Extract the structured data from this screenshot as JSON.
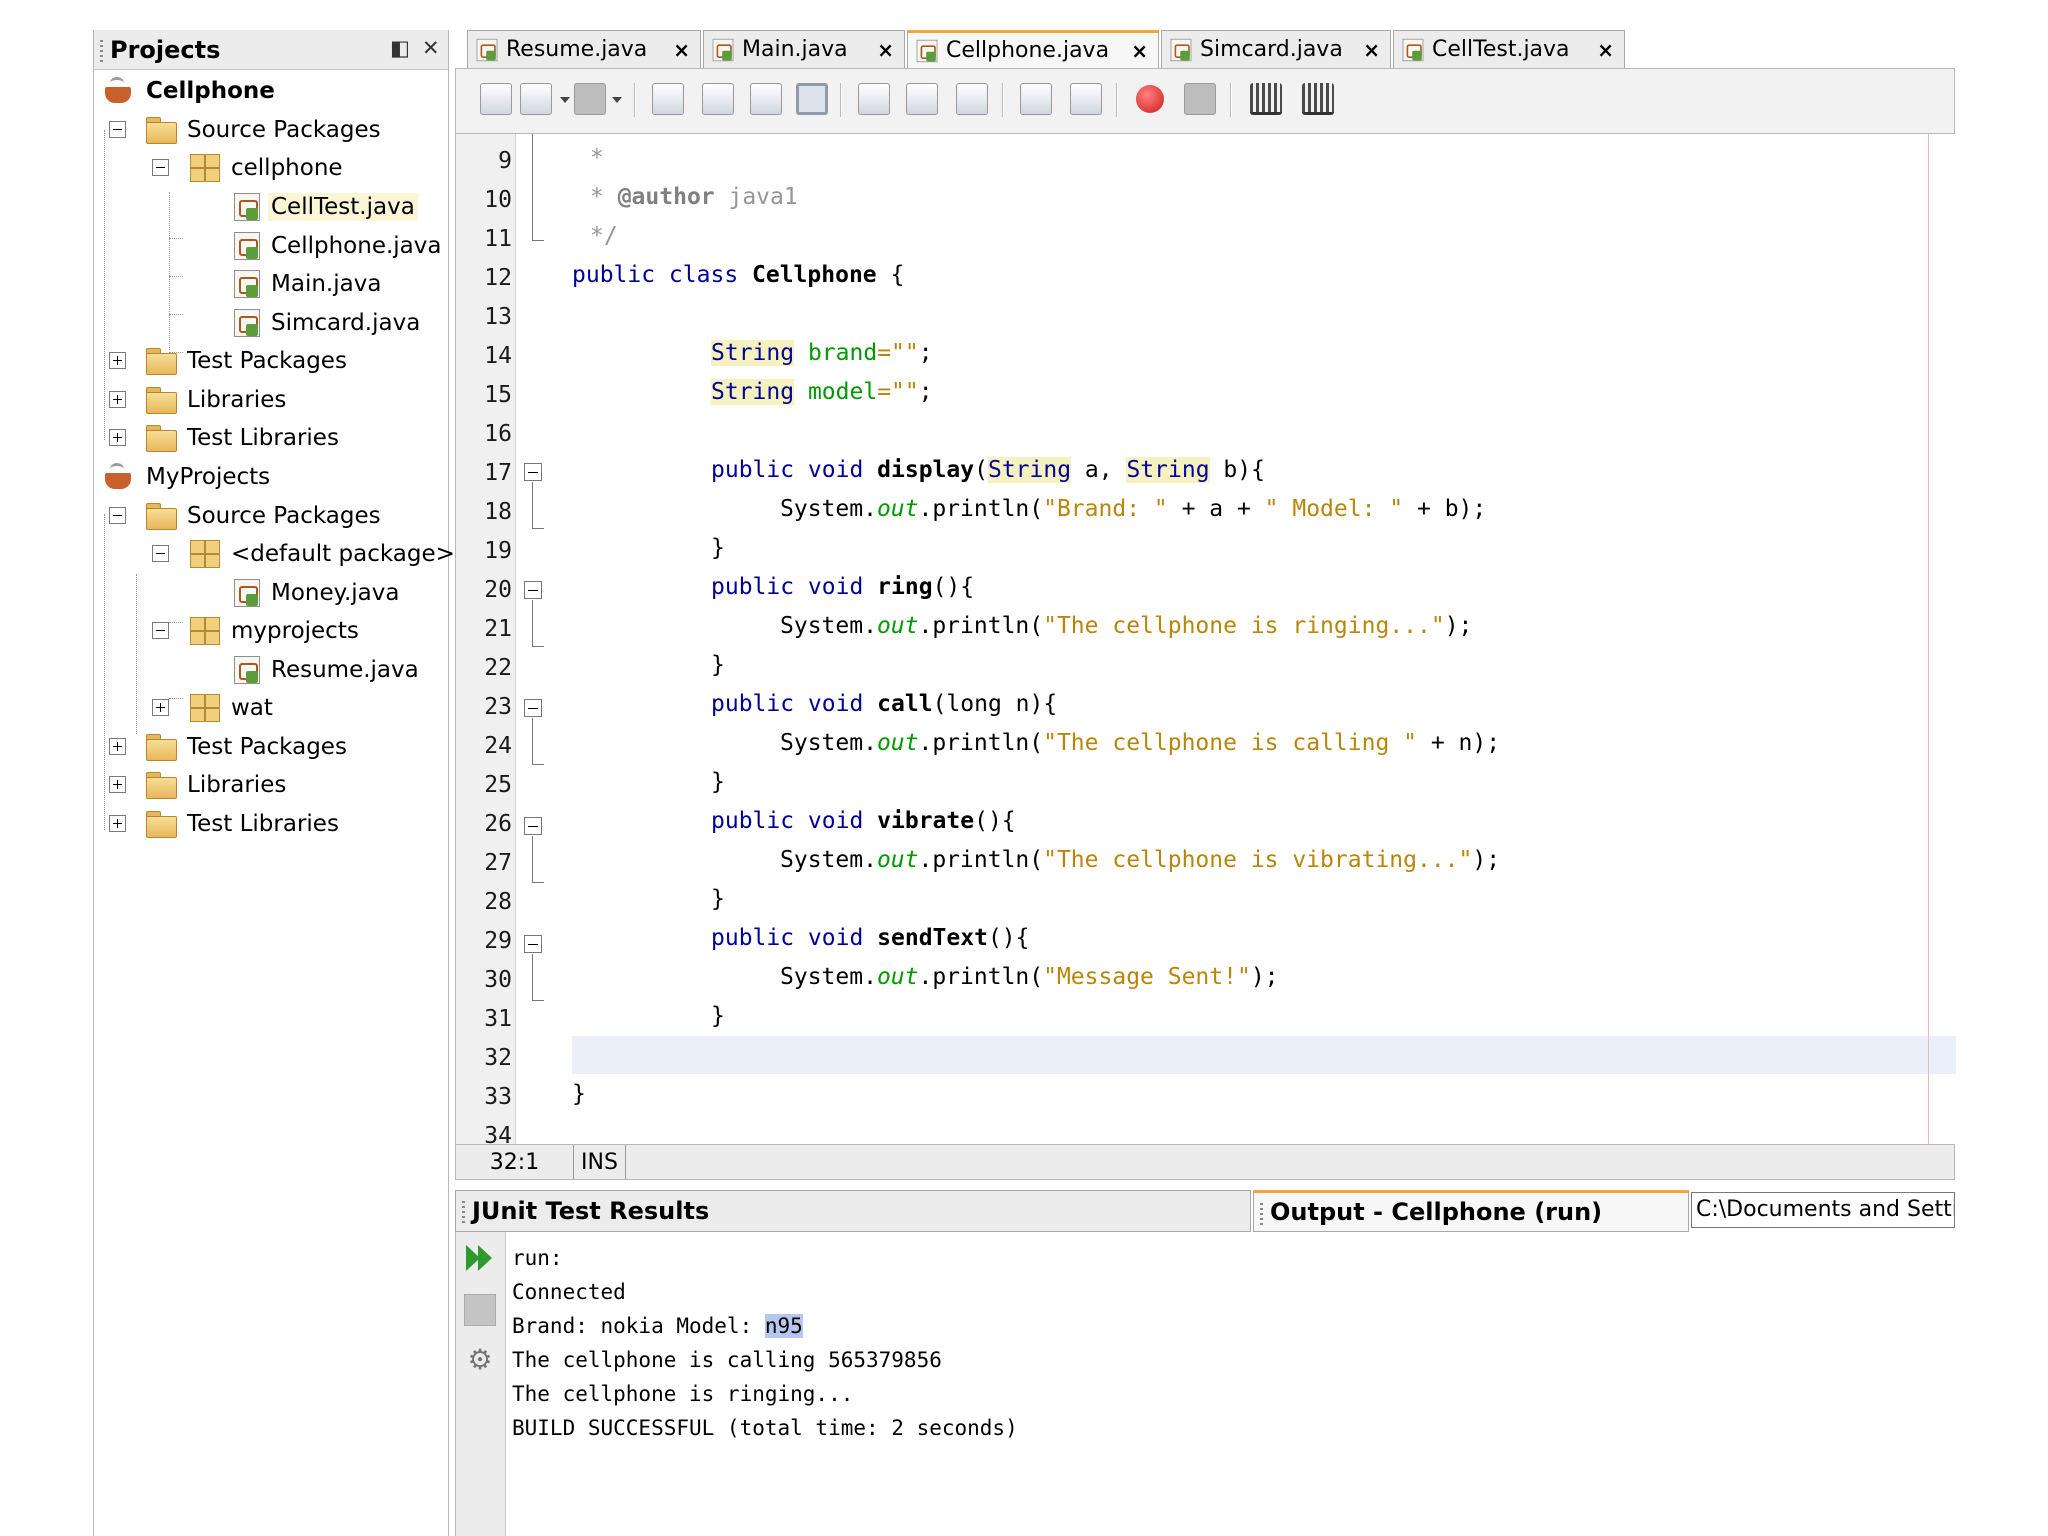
{
  "projects_panel": {
    "title": "Projects",
    "tree": [
      {
        "label": "Cellphone",
        "icon": "project-icon",
        "bold": true
      },
      {
        "label": "Source Packages",
        "icon": "folder-icon"
      },
      {
        "label": "cellphone",
        "icon": "package-icon"
      },
      {
        "label": "CellTest.java",
        "icon": "java-file-icon",
        "selected": true
      },
      {
        "label": "Cellphone.java",
        "icon": "java-file-icon"
      },
      {
        "label": "Main.java",
        "icon": "java-file-icon"
      },
      {
        "label": "Simcard.java",
        "icon": "java-file-icon"
      },
      {
        "label": "Test Packages",
        "icon": "folder-icon"
      },
      {
        "label": "Libraries",
        "icon": "folder-icon"
      },
      {
        "label": "Test Libraries",
        "icon": "folder-icon"
      },
      {
        "label": "MyProjects",
        "icon": "project-icon"
      },
      {
        "label": "Source Packages",
        "icon": "folder-icon"
      },
      {
        "label": "<default package>",
        "icon": "package-icon"
      },
      {
        "label": "Money.java",
        "icon": "java-file-icon"
      },
      {
        "label": "myprojects",
        "icon": "package-icon"
      },
      {
        "label": "Resume.java",
        "icon": "java-file-icon"
      },
      {
        "label": "wat",
        "icon": "package-icon"
      },
      {
        "label": "Test Packages",
        "icon": "folder-icon"
      },
      {
        "label": "Libraries",
        "icon": "folder-icon"
      },
      {
        "label": "Test Libraries",
        "icon": "folder-icon"
      }
    ]
  },
  "editor_tabs": [
    "Resume.java",
    "Main.java",
    "Cellphone.java",
    "Simcard.java",
    "CellTest.java"
  ],
  "active_tab": "Cellphone.java",
  "code": {
    "line_numbers": [
      "9",
      "10",
      "11",
      "12",
      "13",
      "14",
      "15",
      "16",
      "17",
      "18",
      "19",
      "20",
      "21",
      "22",
      "23",
      "24",
      "25",
      "26",
      "27",
      "28",
      "29",
      "30",
      "31",
      "32",
      "33",
      "34"
    ],
    "l9": "*",
    "l10_star": "* ",
    "l10_tag": "@author",
    "l10_rest": " java1",
    "l11": "*/",
    "l12_kw": "public class ",
    "l12_name": "Cellphone",
    "l12_rest": " {",
    "type_string": "String",
    "l14_field": " brand",
    "l14_str": "=\"\"",
    "l15_field": " model",
    "l15_str": "=\"\"",
    "semicolon": ";",
    "public_void": "public void ",
    "m_display": "display",
    "m_ring": "ring",
    "m_call": "call",
    "m_vibrate": "vibrate",
    "m_sendtext": "sendText",
    "l17_mid1": "(",
    "l17_mid2": " a, ",
    "l17_end": " b){",
    "empty_params": "(){",
    "l23_params": "(long n){",
    "sys": "System.",
    "out": "out",
    "println_open": ".println(",
    "l18_s1": "\"Brand: \"",
    "l18_m1": " + a + ",
    "l18_s2": "\" Model: \"",
    "l18_m2": " + b);",
    "l21_s": "\"The cellphone is ringing...\"",
    "l24_s": "\"The cellphone is calling \"",
    "l24_m": " + n);",
    "l27_s": "\"The cellphone is vibrating...\"",
    "l30_s": "\"Message Sent!\"",
    "close_paren": ");",
    "brace_close": "}"
  },
  "status_bar": {
    "position": "32:1",
    "mode": "INS"
  },
  "output_panel": {
    "tab_junit": "JUnit Test Results",
    "tab_output": "Output - Cellphone (run)",
    "path": "C:\\Documents and Settin",
    "lines": [
      "run:",
      "Connected",
      "The cellphone is calling 565379856",
      "The cellphone is ringing...",
      "BUILD SUCCESSFUL (total time: 2 seconds)"
    ],
    "brand_line_prefix": "Brand: nokia Model: ",
    "brand_line_selected": "n95"
  },
  "colors": {
    "keyword": "#000099",
    "string": "#b8860b",
    "field": "#009900",
    "comment": "#969696",
    "active_tab_accent": "#f0a640",
    "selection": "#b5c7ee"
  }
}
